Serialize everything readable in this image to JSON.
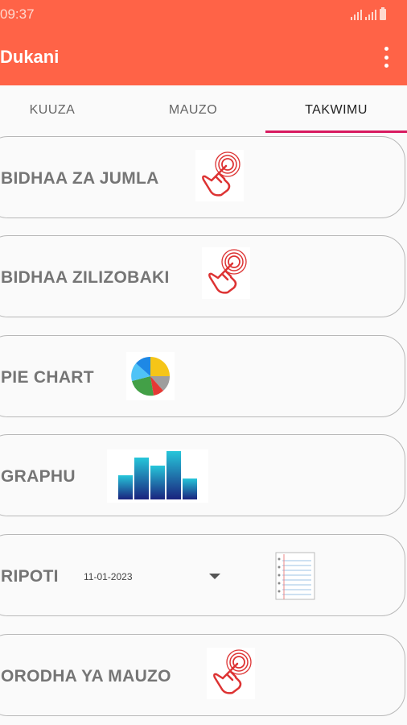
{
  "status": {
    "time": "09:37",
    "icons": [
      "signal-icon",
      "signal-icon",
      "battery-icon"
    ]
  },
  "app_bar": {
    "title": "Dukani",
    "menu_icon": "more-vert-icon"
  },
  "tabs": [
    {
      "label": "KUUZA",
      "active": false
    },
    {
      "label": "MAUZO",
      "active": false
    },
    {
      "label": "TAKWIMU",
      "active": true
    }
  ],
  "colors": {
    "primary": "#ff6347",
    "tab_indicator": "#d81b60",
    "card_text": "#757575"
  },
  "cards": [
    {
      "label": "BIDHAA ZA JUMLA",
      "icon": "tap-hand-icon"
    },
    {
      "label": "BIDHAA ZILIZOBAKI",
      "icon": "tap-hand-icon"
    },
    {
      "label": "PIE CHART",
      "icon": "pie-chart-icon"
    },
    {
      "label": "GRAPHU",
      "icon": "bar-chart-icon"
    },
    {
      "label": "RIPOTI",
      "icon": "notepad-icon",
      "date": "11-01-2023"
    },
    {
      "label": "ORODHA YA MAUZO",
      "icon": "tap-hand-icon"
    }
  ]
}
